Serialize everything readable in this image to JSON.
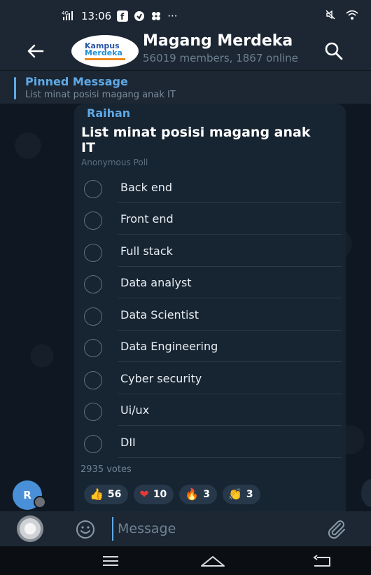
{
  "status_bar": {
    "network": "4G",
    "time": "13:06",
    "more": "···"
  },
  "header": {
    "back_icon": "arrow-left-icon",
    "avatar_logo_line1": "Kampus",
    "avatar_logo_line2": "Merdeka",
    "title": "Magang Merdeka",
    "subtitle": "56019 members, 1867 online",
    "search_icon": "search-icon"
  },
  "pinned": {
    "title": "Pinned Message",
    "text": "List minat posisi magang anak IT"
  },
  "message": {
    "sender": "Raihan",
    "sender_avatar_initial": "R",
    "question": "List minat posisi magang anak IT",
    "poll_type": "Anonymous Poll",
    "options": [
      "Back end",
      "Front end",
      "Full stack",
      "Data analyst",
      "Data Scientist",
      "Data Engineering",
      "Cyber security",
      "Ui/ux",
      "DII"
    ],
    "votes": "2935 votes",
    "reactions": [
      {
        "emoji": "👍",
        "count": "56"
      },
      {
        "emoji": "❤",
        "count": "10"
      },
      {
        "emoji": "🔥",
        "count": "3"
      },
      {
        "emoji": "👏",
        "count": "3"
      }
    ]
  },
  "input_bar": {
    "placeholder": "Message",
    "emoji_icon": "smiley-icon",
    "attach_icon": "paperclip-icon"
  },
  "nav_bar": {
    "buttons": [
      "menu-icon",
      "home-icon",
      "back-icon"
    ]
  },
  "colors": {
    "accent": "#5fa9e6",
    "header_bg": "#1c2733",
    "bubble_bg": "#172431"
  }
}
